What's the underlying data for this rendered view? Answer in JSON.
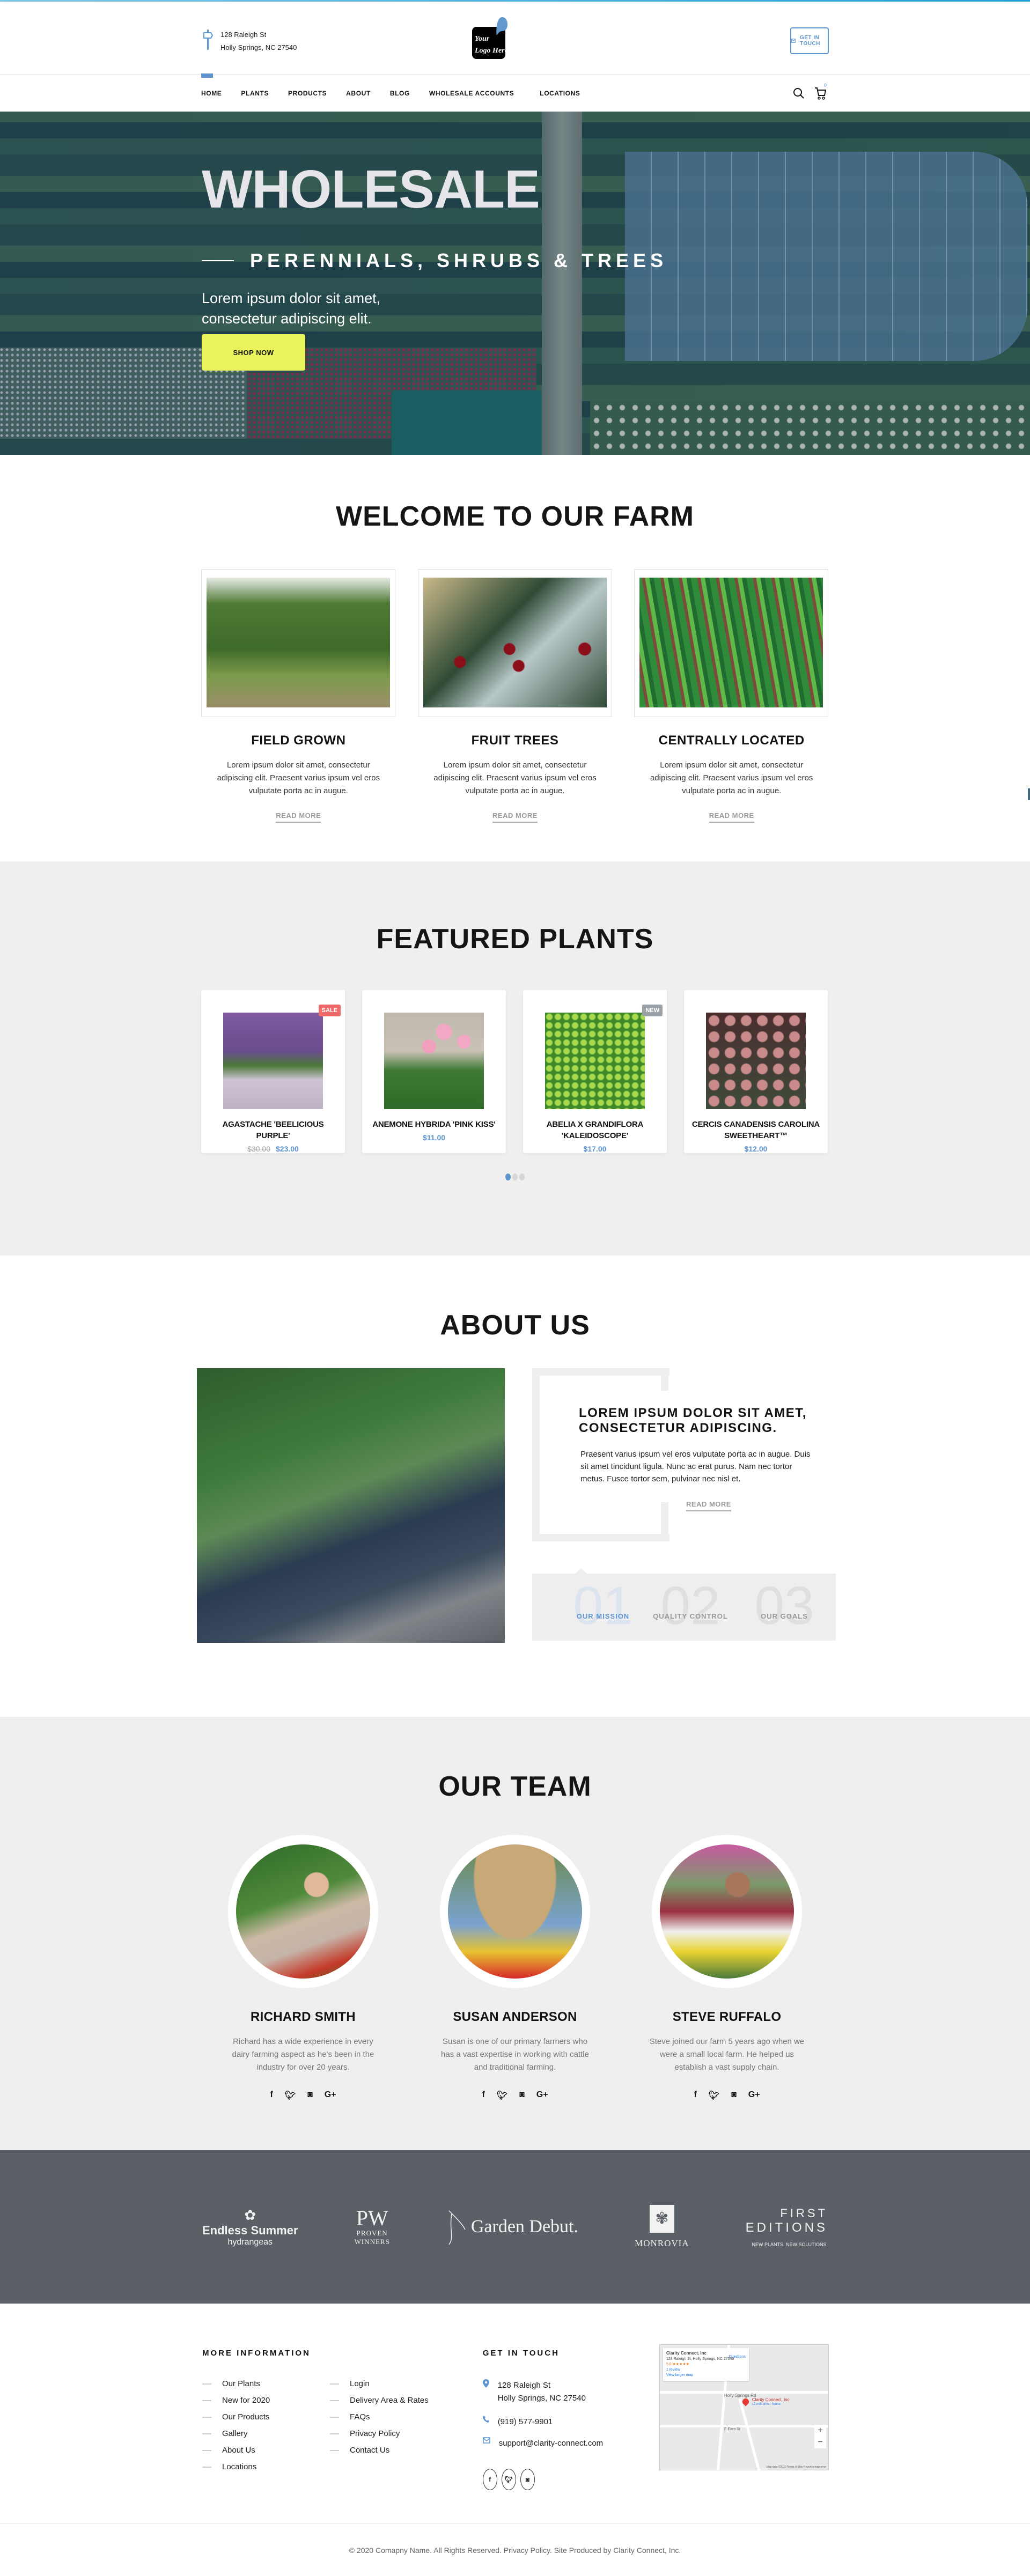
{
  "header": {
    "address_line1": "128 Raleigh St",
    "address_line2": "Holly Springs, NC 27540",
    "logo_line1": "Your",
    "logo_line2": "Logo Here",
    "cta_label": "GET IN TOUCH",
    "cart_count": "0",
    "accent_color": "#5d95d0"
  },
  "nav": {
    "items": [
      "HOME",
      "PLANTS",
      "PRODUCTS",
      "ABOUT",
      "BLOG",
      "WHOLESALE ACCOUNTS",
      "LOCATIONS"
    ],
    "active": "HOME"
  },
  "hero": {
    "title": "WHOLESALE",
    "subtitle": "PERENNIALS, SHRUBS & TREES",
    "text_line1": "Lorem ipsum dolor sit amet,",
    "text_line2": "consectetur adipiscing elit.",
    "button": "SHOP NOW",
    "button_color": "#e9f35b"
  },
  "welcome": {
    "title": "WELCOME TO OUR FARM",
    "features": [
      {
        "title": "FIELD GROWN",
        "text": "Lorem ipsum dolor sit amet, consectetur adipiscing elit. Praesent varius ipsum vel eros vulputate porta ac in augue.",
        "link": "READ MORE"
      },
      {
        "title": "FRUIT TREES",
        "text": "Lorem ipsum dolor sit amet, consectetur adipiscing elit. Praesent varius ipsum vel eros vulputate porta ac in augue.",
        "link": "READ MORE"
      },
      {
        "title": "CENTRALLY LOCATED",
        "text": "Lorem ipsum dolor sit amet, consectetur adipiscing elit. Praesent varius ipsum vel eros vulputate porta ac in augue.",
        "link": "READ MORE"
      }
    ]
  },
  "featured": {
    "title": "FEATURED PLANTS",
    "products": [
      {
        "name": "AGASTACHE 'BEELICIOUS PURPLE'",
        "old_price": "$30.00",
        "price": "$23.00",
        "badge": "SALE",
        "badge_color": "#f06b6b"
      },
      {
        "name": "ANEMONE HYBRIDA 'PINK KISS'",
        "old_price": "",
        "price": "$11.00",
        "badge": "",
        "badge_color": ""
      },
      {
        "name": "ABELIA X GRANDIFLORA 'KALEIDOSCOPE'",
        "old_price": "",
        "price": "$17.00",
        "badge": "NEW",
        "badge_color": "#9aa3a8"
      },
      {
        "name": "CERCIS CANADENSIS CAROLINA SWEETHEART™",
        "old_price": "",
        "price": "$12.00",
        "badge": "",
        "badge_color": ""
      }
    ],
    "carousel_pages": 3,
    "carousel_active": 1
  },
  "about": {
    "title": "ABOUT US",
    "heading": "LOREM IPSUM DOLOR SIT AMET, CONSECTETUR ADIPISCING.",
    "text": "Praesent varius ipsum vel eros vulputate porta ac in augue. Duis sit amet tincidunt ligula. Nunc ac erat purus.  Nam nec tortor metus. Fusce tortor sem, pulvinar nec nisl et.",
    "link": "READ MORE",
    "tabs": [
      {
        "num": "01",
        "label": "OUR MISSION",
        "active": true
      },
      {
        "num": "02",
        "label": "QUALITY CONTROL",
        "active": false
      },
      {
        "num": "03",
        "label": "OUR GOALS",
        "active": false
      }
    ]
  },
  "team": {
    "title": "OUR TEAM",
    "members": [
      {
        "name": "RICHARD SMITH",
        "bio": "Richard has a wide experience in every dairy farming aspect as he's been in the industry for over 20 years."
      },
      {
        "name": "SUSAN ANDERSON",
        "bio": "Susan is one of our primary farmers who has a vast expertise in working with cattle and traditional farming."
      },
      {
        "name": "STEVE RUFFALO",
        "bio": "Steve joined our farm 5 years ago when we were a small local farm. He helped us establish a vast supply chain."
      }
    ],
    "social_icons": [
      "facebook-icon",
      "twitter-icon",
      "instagram-icon",
      "google-plus-icon"
    ]
  },
  "brands": {
    "endless_summer": "Endless Summer",
    "endless_summer_sub": "hydrangeas",
    "proven_winners": "PW",
    "proven_winners_sub1": "PROVEN",
    "proven_winners_sub2": "WINNERS",
    "garden_debut": "Garden Debut.",
    "monrovia": "MONROVIA",
    "first_editions_1": "FIRST",
    "first_editions_2": "EDITIONS",
    "first_editions_sub": "NEW PLANTS. NEW SOLUTIONS."
  },
  "footer": {
    "more_info_title": "MORE INFORMATION",
    "links_col1": [
      "Our Plants",
      "New for 2020",
      "Our Products",
      "Gallery",
      "About Us",
      "Locations"
    ],
    "links_col2": [
      "Login",
      "Delivery Area & Rates",
      "FAQs",
      "Privacy Policy",
      "Contact Us"
    ],
    "contact_title": "GET IN TOUCH",
    "address_line1": "128 Raleigh St",
    "address_line2": "Holly Springs, NC 27540",
    "phone": "(919) 577-9901",
    "email": "support@clarity-connect.com",
    "map": {
      "place": "Clarity Connect, Inc",
      "address": "128 Raleigh St, Holly Springs, NC 27540",
      "rating": "5.0 ★★★★★",
      "reviews": "1 review",
      "larger": "View larger map",
      "directions": "Directions",
      "road1": "Holly Springs Rd",
      "road2": "E Earp St",
      "pin_sub": "12 min drive - home",
      "credits": "Map data ©2020  Terms of Use  Report a map error"
    },
    "copyright": "© 2020 Comapny Name.  All Rights Reserved. Privacy Policy. Site Produced by Clarity Connect, Inc."
  }
}
